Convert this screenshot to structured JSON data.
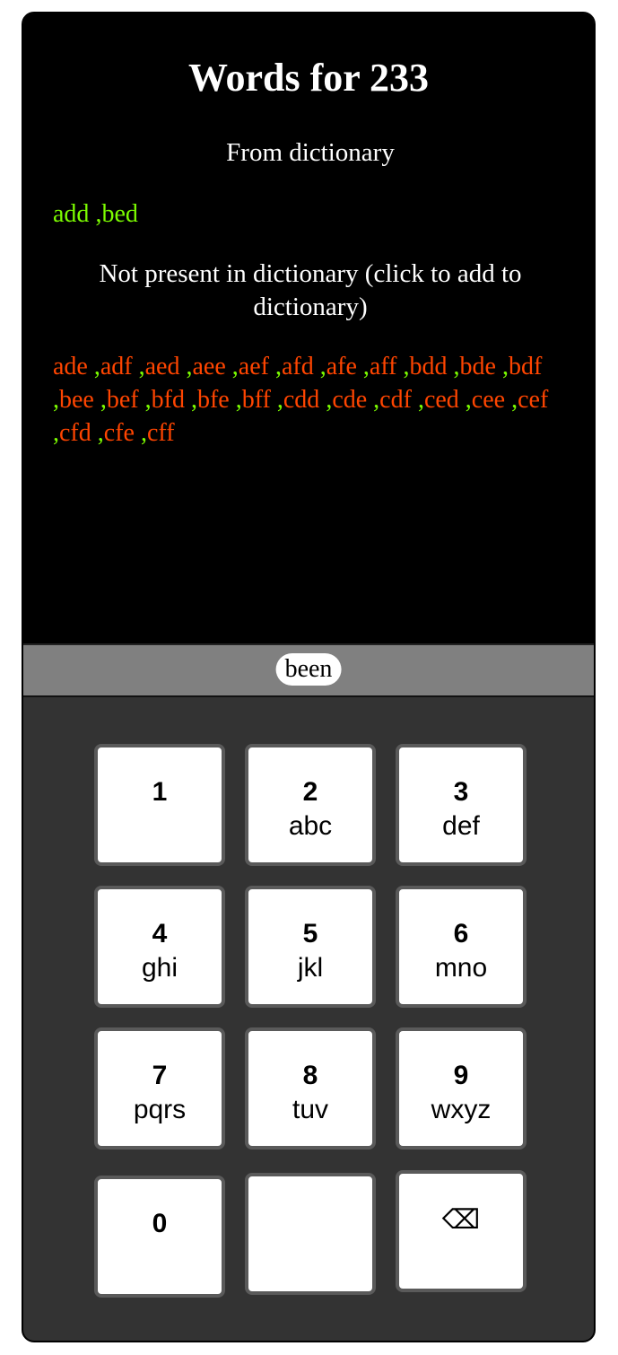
{
  "header": {
    "title": "Words for 233"
  },
  "dictionary": {
    "heading": "From dictionary",
    "words": [
      "add",
      "bed"
    ]
  },
  "not_in_dictionary": {
    "heading": "Not present in dictionary (click to add to dictionary)",
    "words": [
      "ade",
      "adf",
      "aed",
      "aee",
      "aef",
      "afd",
      "afe",
      "aff",
      "bdd",
      "bde",
      "bdf",
      "bee",
      "bef",
      "bfd",
      "bfe",
      "bff",
      "cdd",
      "cde",
      "cdf",
      "ced",
      "cee",
      "cef",
      "cfd",
      "cfe",
      "cff"
    ]
  },
  "suggestion": {
    "word": "been"
  },
  "keypad": {
    "keys": [
      {
        "num": "1",
        "letters": ""
      },
      {
        "num": "2",
        "letters": "abc"
      },
      {
        "num": "3",
        "letters": "def"
      },
      {
        "num": "4",
        "letters": "ghi"
      },
      {
        "num": "5",
        "letters": "jkl"
      },
      {
        "num": "6",
        "letters": "mno"
      },
      {
        "num": "7",
        "letters": "pqrs"
      },
      {
        "num": "8",
        "letters": "tuv"
      },
      {
        "num": "9",
        "letters": "wxyz"
      },
      {
        "num": "0",
        "letters": ""
      },
      {
        "num": "",
        "letters": ""
      },
      {
        "num": "⌫",
        "letters": ""
      }
    ]
  },
  "colors": {
    "in_dictionary": "#7cfc00",
    "not_in_dictionary": "#ff4500",
    "display_bg": "#000000",
    "keypad_bg": "#333333",
    "suggest_bg": "#808080"
  }
}
